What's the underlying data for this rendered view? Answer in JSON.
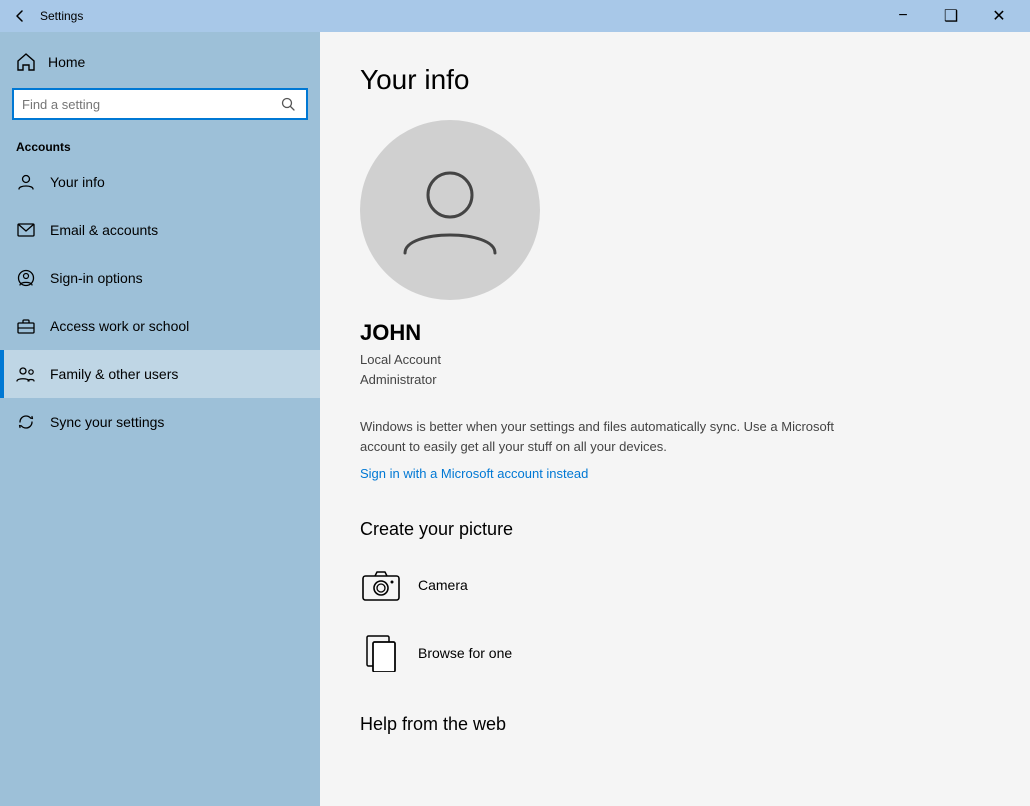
{
  "titlebar": {
    "title": "Settings",
    "minimize": "−",
    "maximize": "❑",
    "close": "✕"
  },
  "sidebar": {
    "home_label": "Home",
    "search_placeholder": "Find a setting",
    "accounts_label": "Accounts",
    "items": [
      {
        "id": "your-info",
        "label": "Your info",
        "active": false
      },
      {
        "id": "email-accounts",
        "label": "Email & accounts",
        "active": false
      },
      {
        "id": "sign-in-options",
        "label": "Sign-in options",
        "active": false
      },
      {
        "id": "access-work-school",
        "label": "Access work or school",
        "active": false
      },
      {
        "id": "family-other-users",
        "label": "Family & other users",
        "active": true
      },
      {
        "id": "sync-settings",
        "label": "Sync your settings",
        "active": false
      }
    ]
  },
  "content": {
    "page_title": "Your info",
    "user_name": "JOHN",
    "user_account_type": "Local Account",
    "user_role": "Administrator",
    "promo_text": "Windows is better when your settings and files automatically sync. Use a Microsoft account to easily get all your stuff on all your devices.",
    "ms_account_link": "Sign in with a Microsoft account instead",
    "create_picture_title": "Create your picture",
    "picture_options": [
      {
        "id": "camera",
        "label": "Camera"
      },
      {
        "id": "browse",
        "label": "Browse for one"
      }
    ],
    "help_title": "Help from the web"
  }
}
